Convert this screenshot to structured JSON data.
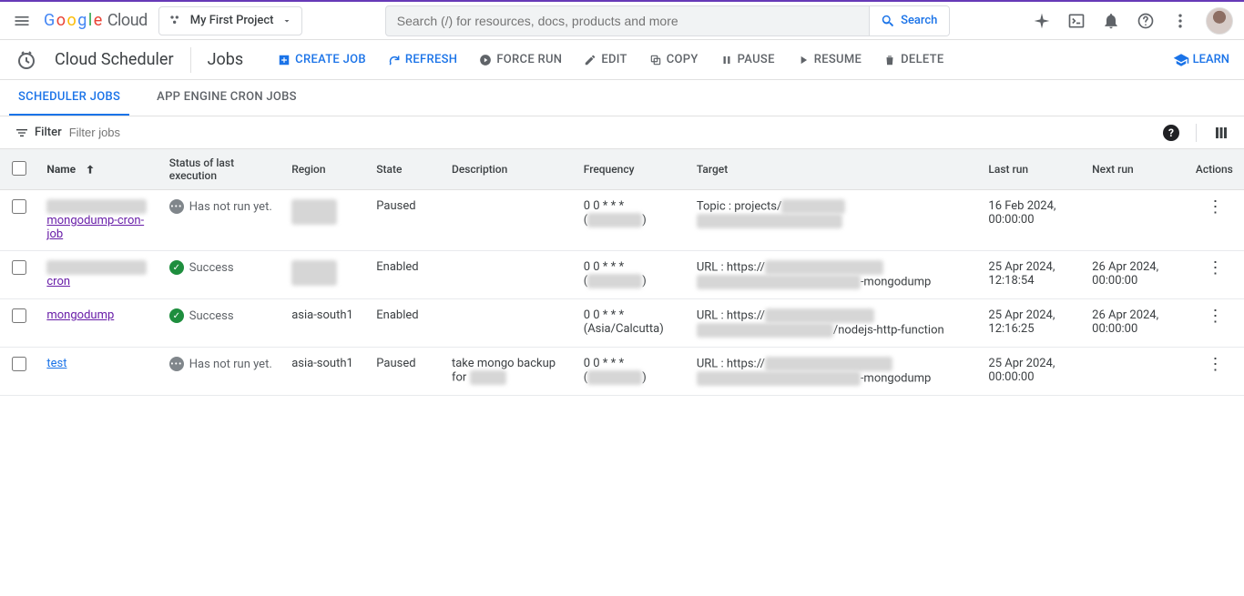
{
  "header": {
    "project": "My First Project",
    "search_placeholder": "Search (/) for resources, docs, products and more",
    "search_btn": "Search"
  },
  "service": {
    "name": "Cloud Scheduler",
    "page": "Jobs",
    "learn": "LEARN"
  },
  "toolbar": {
    "create": "CREATE JOB",
    "refresh": "REFRESH",
    "forcerun": "FORCE RUN",
    "edit": "EDIT",
    "copy": "COPY",
    "pause": "PAUSE",
    "resume": "RESUME",
    "delete": "DELETE"
  },
  "tabs": {
    "scheduler": "SCHEDULER JOBS",
    "appengine": "APP ENGINE CRON JOBS"
  },
  "filter": {
    "label": "Filter",
    "placeholder": "Filter jobs"
  },
  "columns": {
    "name": "Name",
    "status": "Status of last execution",
    "region": "Region",
    "state": "State",
    "description": "Description",
    "frequency": "Frequency",
    "target": "Target",
    "lastrun": "Last run",
    "nextrun": "Next run",
    "actions": "Actions"
  },
  "status_labels": {
    "notrun": "Has not run yet.",
    "success": "Success"
  },
  "rows": [
    {
      "name_redacted": true,
      "name_suffix": "mongodump-cron-job",
      "name_visited": true,
      "status": "notrun",
      "region_redacted": true,
      "region": "",
      "state": "Paused",
      "description": "",
      "freq_line1": "0 0 * * *",
      "freq_line2_redacted": true,
      "target_prefix": "Topic : projects/",
      "target_l1_redacted_w": 70,
      "target_l2_redacted_w": 160,
      "target_suffix": "",
      "last": "16 Feb 2024, 00:00:00",
      "next": ""
    },
    {
      "name_redacted": true,
      "name_suffix": "cron",
      "name_visited": true,
      "status": "success",
      "region_redacted": true,
      "region": "",
      "state": "Enabled",
      "description": "",
      "freq_line1": "0 0 * * *",
      "freq_line2_redacted": true,
      "target_prefix": "URL : https://",
      "target_l1_redacted_w": 130,
      "target_l2_redacted_w": 180,
      "target_suffix": "-mongodump",
      "last": "25 Apr 2024, 12:18:54",
      "next": "26 Apr 2024, 00:00:00"
    },
    {
      "name_redacted": false,
      "name_suffix": "mongodump",
      "name_visited": true,
      "status": "success",
      "region_redacted": false,
      "region": "asia-south1",
      "state": "Enabled",
      "description": "",
      "freq_line1": "0 0 * * *",
      "freq_line2": "(Asia/Calcutta)",
      "target_prefix": "URL : https://",
      "target_l1_redacted_w": 120,
      "target_l2_redacted_w": 150,
      "target_suffix": "/nodejs-http-function",
      "last": "25 Apr 2024, 12:16:25",
      "next": "26 Apr 2024, 00:00:00"
    },
    {
      "name_redacted": false,
      "name_suffix": "test",
      "name_visited": false,
      "status": "notrun",
      "region_redacted": false,
      "region": "asia-south1",
      "state": "Paused",
      "description_pre": "take mongo backup for",
      "description_redacted_w": 40,
      "freq_line1": "0 0 * * *",
      "freq_line2_redacted": true,
      "target_prefix": "URL : https://",
      "target_l1_redacted_w": 140,
      "target_l2_redacted_w": 180,
      "target_suffix": "-mongodump",
      "last": "25 Apr 2024, 00:00:00",
      "next": ""
    }
  ]
}
